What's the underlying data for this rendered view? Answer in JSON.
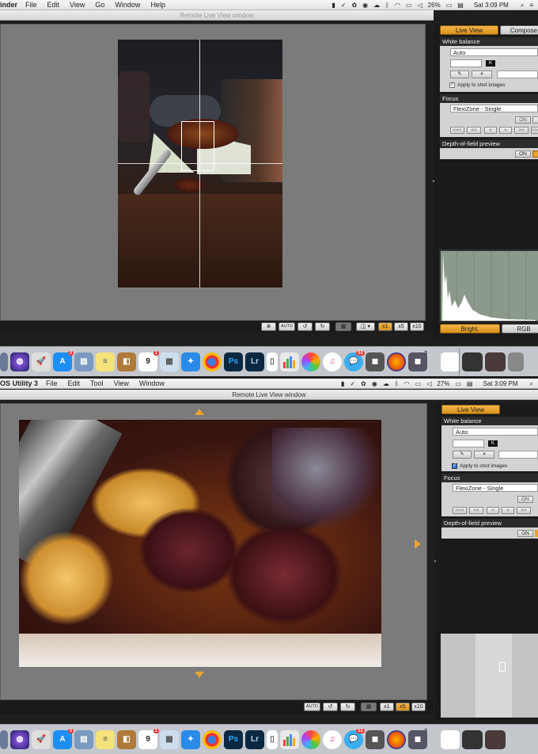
{
  "top": {
    "menubar": {
      "app": "inder",
      "menus": [
        "File",
        "Edit",
        "View",
        "Go",
        "Window",
        "Help"
      ],
      "battery": "26%",
      "clock": "Sat 3:09 PM"
    },
    "window_title": "Remote Live View window",
    "tabs": [
      "Live View",
      "Compose"
    ],
    "white_balance": {
      "title": "White balance",
      "value": "Auto",
      "k_label": "K",
      "apply_label": "Apply to shot images"
    },
    "focus": {
      "title": "Focus",
      "mode": "FlexiZone - Single",
      "on_label": "ON",
      "nav": [
        "<<<",
        "<<",
        "<",
        ">",
        ">>",
        ">>>"
      ]
    },
    "dof": {
      "title": "Depth-of-field preview",
      "on_label": "ON"
    },
    "hist_tabs": [
      "Bright.",
      "RGB"
    ],
    "toolbar": [
      "AUTO",
      "x1",
      "x5",
      "x10"
    ]
  },
  "dock_badges": {
    "appstore": "3",
    "calendar_day": "9",
    "calendar_badge": "1",
    "messages": "51",
    "safari2": "3"
  },
  "bottom": {
    "menubar": {
      "app": "OS Utility 3",
      "menus": [
        "File",
        "Edit",
        "Tool",
        "View",
        "Window"
      ],
      "battery": "27%",
      "clock": "Sat 3:09 PM"
    },
    "window_title": "Remote Live View window",
    "tabs": [
      "Live View"
    ],
    "white_balance": {
      "title": "White balance",
      "value": "Auto",
      "k_label": "K",
      "apply_label": "Apply to shot images"
    },
    "focus": {
      "title": "Focus",
      "mode": "FlexiZone - Single",
      "on_label": "ON",
      "nav": [
        "<<<",
        "<<",
        "<",
        ">",
        ">>",
        ">>>"
      ]
    },
    "dof": {
      "title": "Depth-of-field preview",
      "on_label": "ON"
    },
    "toolbar": [
      "AUTO",
      "x1",
      "x5",
      "x10"
    ]
  },
  "dock_apps": [
    "Ps",
    "Lr"
  ],
  "colors": {
    "accent": "#e8a22e",
    "view_bg": "#7b7b7b",
    "panel_bg": "#1a1a1a"
  }
}
